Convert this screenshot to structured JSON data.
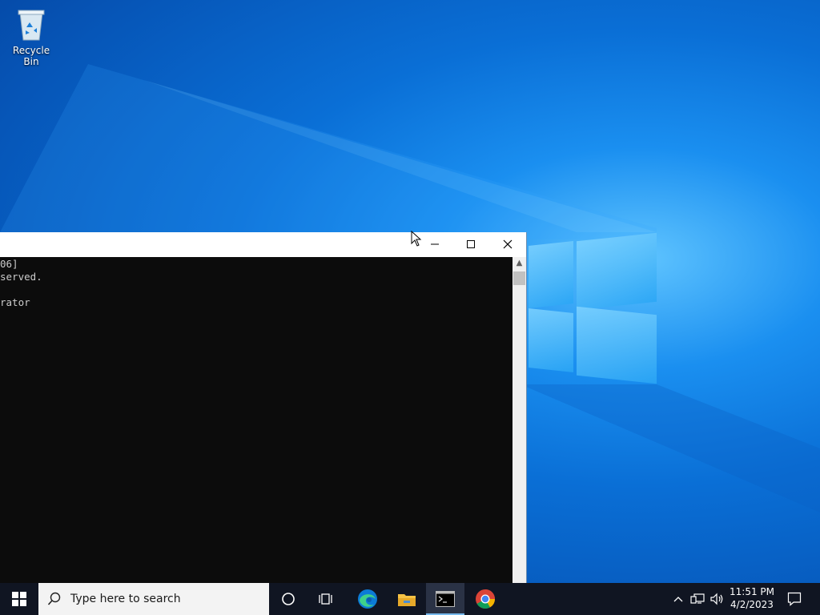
{
  "desktop": {
    "icons": [
      {
        "label": "Recycle Bin",
        "icon": "recycle-bin-icon"
      }
    ]
  },
  "console_window": {
    "title": "",
    "controls": {
      "minimize": "–",
      "maximize": "□",
      "close": "✕"
    },
    "lines": [
      "06]",
      "served.",
      "",
      "rator"
    ]
  },
  "taskbar": {
    "search_placeholder": "Type here to search",
    "apps": [
      {
        "name": "Task View",
        "icon": "task-view-icon"
      },
      {
        "name": "Microsoft Edge",
        "icon": "edge-icon"
      },
      {
        "name": "File Explorer",
        "icon": "folder-icon"
      },
      {
        "name": "Command Prompt",
        "icon": "cmd-icon",
        "active": true
      },
      {
        "name": "Google Chrome",
        "icon": "chrome-icon"
      }
    ],
    "clock": {
      "time": "11:51 PM",
      "date": "4/2/2023"
    },
    "colors": {
      "taskbar_bg": "#101522",
      "active_indicator": "#76b9ed",
      "desktop_blue": "#0a6fd6"
    }
  }
}
